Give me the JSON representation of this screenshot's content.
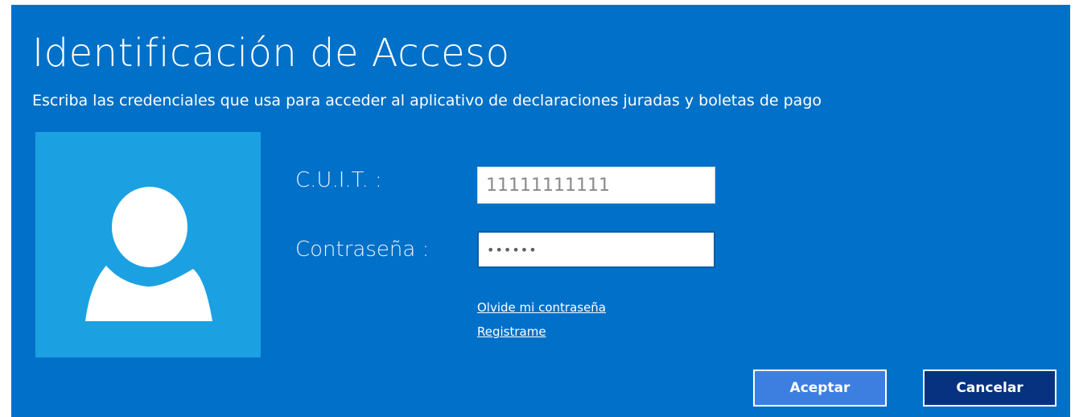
{
  "dialog": {
    "title": "Identificación de Acceso",
    "subtitle": "Escriba las credenciales que usa para acceder al aplicativo de declaraciones juradas y boletas de pago",
    "avatar_icon": "user-silhouette-icon",
    "colors": {
      "background": "#0170c8",
      "avatar_tile": "#1ba1e2",
      "accept_button": "#3d7fe0",
      "cancel_button": "#06327f"
    }
  },
  "form": {
    "cuit_label": "C.U.I.T. :",
    "cuit_value": "11111111111",
    "password_label": "Contraseña :",
    "password_value": "••••••",
    "forgot_link": "Olvide mi contraseña",
    "register_link": "Registrame"
  },
  "buttons": {
    "accept": "Aceptar",
    "cancel": "Cancelar"
  }
}
